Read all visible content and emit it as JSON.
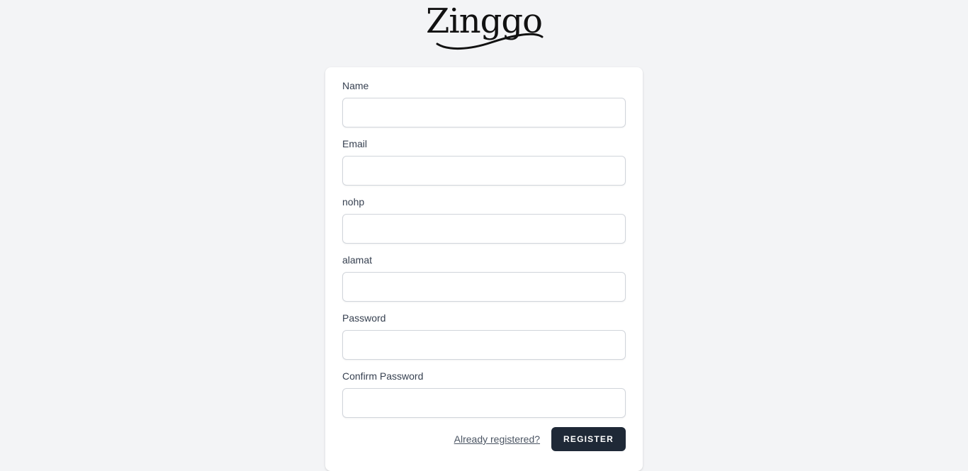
{
  "brand": {
    "logo_text": "Zinggo"
  },
  "form": {
    "fields": [
      {
        "label": "Name",
        "value": "",
        "placeholder": ""
      },
      {
        "label": "Email",
        "value": "",
        "placeholder": ""
      },
      {
        "label": "nohp",
        "value": "",
        "placeholder": ""
      },
      {
        "label": "alamat",
        "value": "",
        "placeholder": ""
      },
      {
        "label": "Password",
        "value": "",
        "placeholder": ""
      },
      {
        "label": "Confirm Password",
        "value": "",
        "placeholder": ""
      }
    ],
    "login_link": "Already registered?",
    "submit_label": "REGISTER"
  },
  "colors": {
    "background": "#f3f4f6",
    "card": "#ffffff",
    "button": "#1f2937",
    "input_border": "#d1d5db"
  }
}
